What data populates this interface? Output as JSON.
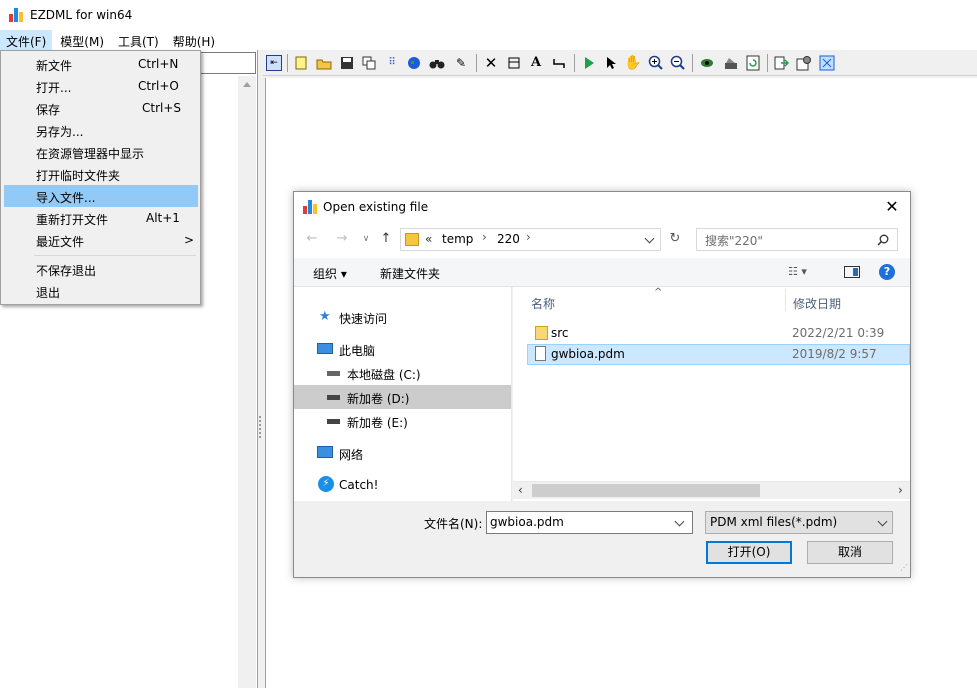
{
  "app": {
    "title": "EZDML for win64",
    "colors": {
      "menu_open_bg": "#cce8ff",
      "menu_selected_bg": "#91c9f7",
      "file_selected_bg": "#cce8ff"
    }
  },
  "menubar": {
    "items": [
      {
        "label": "文件(F)"
      },
      {
        "label": "模型(M)"
      },
      {
        "label": "工具(T)"
      },
      {
        "label": "帮助(H)"
      }
    ]
  },
  "file_menu": {
    "items": [
      {
        "label": "新文件",
        "shortcut": "Ctrl+N"
      },
      {
        "label": "打开...",
        "shortcut": "Ctrl+O"
      },
      {
        "label": "保存",
        "shortcut": "Ctrl+S"
      },
      {
        "label": "另存为...",
        "shortcut": ""
      },
      {
        "label": "在资源管理器中显示",
        "shortcut": ""
      },
      {
        "label": "打开临时文件夹",
        "shortcut": ""
      },
      {
        "label": "导入文件...",
        "shortcut": ""
      },
      {
        "label": "重新打开文件",
        "shortcut": "Alt+1"
      },
      {
        "label": "最近文件",
        "shortcut": ">"
      },
      {
        "label": "不保存退出",
        "shortcut": ""
      },
      {
        "label": "退出",
        "shortcut": ""
      }
    ],
    "selected": "导入文件..."
  },
  "toolbar": {
    "icons": [
      "back-icon",
      "new-icon",
      "open-icon",
      "save-icon",
      "copy-icon",
      "tree-icon",
      "globe-icon",
      "binoculars-icon",
      "pencil-icon",
      "delete-icon",
      "frame-icon",
      "text-icon",
      "link-icon",
      "play-icon",
      "pointer-icon",
      "hand-icon",
      "zoom-in-icon",
      "zoom-out-icon",
      "eye-icon",
      "paint-icon",
      "refresh-icon",
      "export-icon",
      "settings-icon",
      "fit-icon"
    ]
  },
  "dialog": {
    "title": "Open existing file",
    "address": {
      "prefix": "«",
      "crumbs": [
        "temp",
        "220"
      ]
    },
    "search_placeholder": "搜索\"220\"",
    "organize_label": "组织 ▾",
    "new_folder_label": "新建文件夹",
    "nav_items": [
      {
        "label": "快速访问",
        "icon": "star-icon"
      },
      {
        "label": "此电脑",
        "icon": "computer-icon"
      },
      {
        "label": "本地磁盘 (C:)",
        "icon": "drive-icon"
      },
      {
        "label": "新加卷 (D:)",
        "icon": "drive-icon"
      },
      {
        "label": "新加卷 (E:)",
        "icon": "drive-icon"
      },
      {
        "label": "网络",
        "icon": "network-icon"
      },
      {
        "label": "Catch!",
        "icon": "catch-icon"
      }
    ],
    "columns": {
      "name": "名称",
      "modified": "修改日期"
    },
    "files": [
      {
        "name": "src",
        "modified": "2022/2/21 0:39",
        "type": "folder"
      },
      {
        "name": "gwbioa.pdm",
        "modified": "2019/8/2 9:57",
        "type": "file"
      }
    ],
    "filename_label": "文件名(N):",
    "filename_value": "gwbioa.pdm",
    "filetype_value": "PDM xml files(*.pdm)",
    "open_label": "打开(O)",
    "cancel_label": "取消"
  }
}
